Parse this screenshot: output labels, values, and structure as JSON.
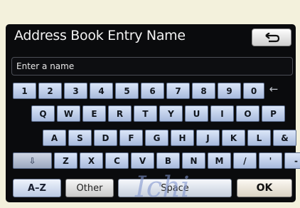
{
  "title": "Address Book Entry Name",
  "back_icon": "back-arrow-icon",
  "input_placeholder": "Enter a name",
  "backspace_icon": "backspace-arrow-icon",
  "rows": [
    [
      "1",
      "2",
      "3",
      "4",
      "5",
      "6",
      "7",
      "8",
      "9",
      "0"
    ],
    [
      "Q",
      "W",
      "E",
      "R",
      "T",
      "Y",
      "U",
      "I",
      "O",
      "P"
    ],
    [
      "A",
      "S",
      "D",
      "F",
      "G",
      "H",
      "J",
      "K",
      "L",
      "&"
    ],
    [
      "⇩",
      "Z",
      "X",
      "C",
      "V",
      "B",
      "N",
      "M",
      "/",
      "'",
      "-"
    ]
  ],
  "buttons": {
    "az": "A–Z",
    "other": "Other",
    "space": "Space",
    "ok": "OK"
  },
  "watermark": "Ichi"
}
